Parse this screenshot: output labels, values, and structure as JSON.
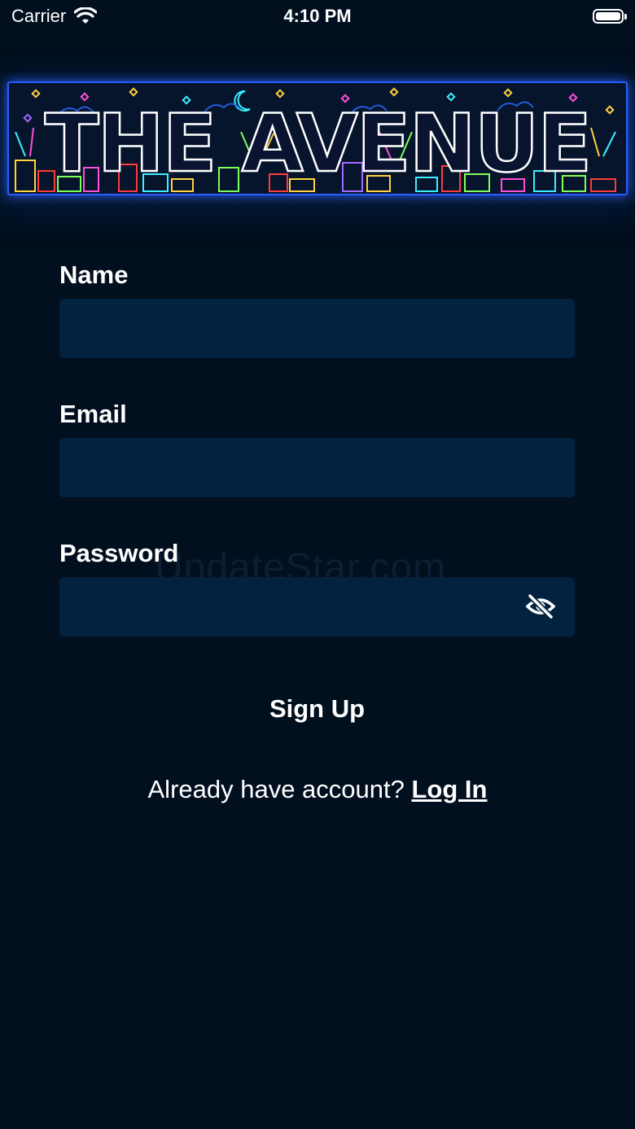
{
  "status_bar": {
    "carrier": "Carrier",
    "time": "4:10 PM"
  },
  "banner": {
    "logo_text": "THE AVENUE"
  },
  "form": {
    "name_label": "Name",
    "email_label": "Email",
    "password_label": "Password",
    "name_value": "",
    "email_value": "",
    "password_value": ""
  },
  "watermark": "UpdateStar.com",
  "signup_button": "Sign Up",
  "login_prompt": {
    "text": "Already have account?",
    "link": "Log In"
  },
  "colors": {
    "background": "#020f1f",
    "field": "#03223f",
    "banner_border": "#2a5cff"
  }
}
